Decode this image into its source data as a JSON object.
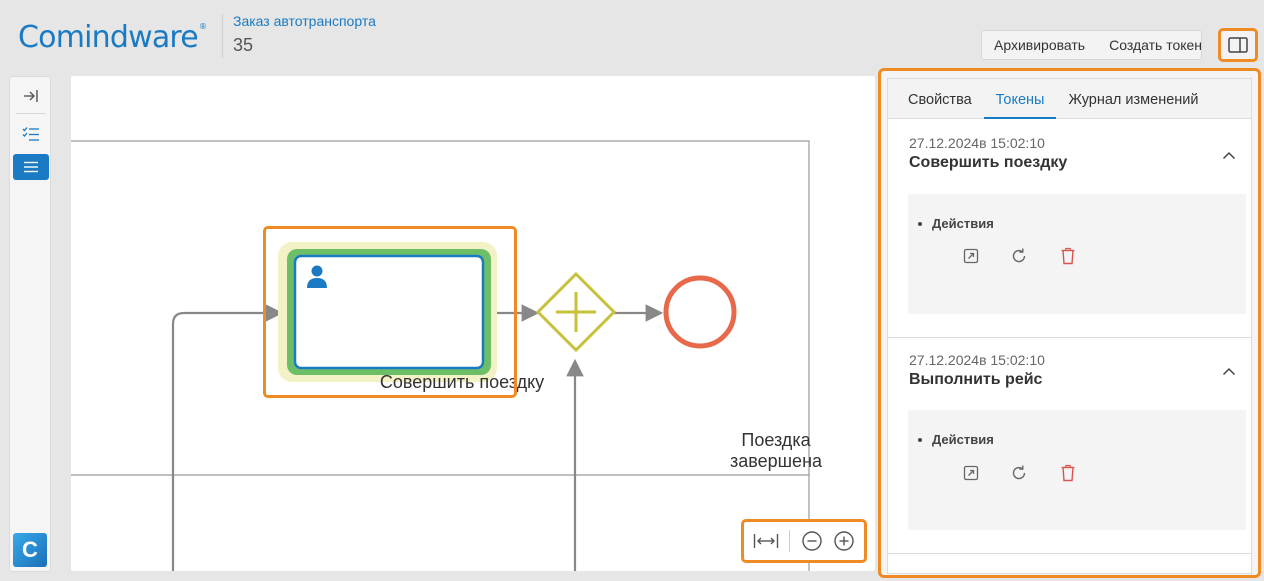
{
  "header": {
    "logo_text": "Comindware",
    "logo_mark": "®",
    "process_title": "Заказ автотранспорта",
    "process_id": "35",
    "toolbar": {
      "archive_label": "Архивировать",
      "create_token_label": "Создать токен"
    },
    "panel_toggle_icon": "panel-toggle-icon"
  },
  "sidebar": {
    "items": [
      {
        "icon": "collapse-arrow-icon"
      },
      {
        "icon": "checklist-icon"
      },
      {
        "icon": "list-icon",
        "active": true
      }
    ],
    "brand_tile_letter": "C"
  },
  "diagram": {
    "task_label": "Совершить поездку",
    "end_event_label": "Поездка завершена",
    "zoom_controls": {
      "fit_icon": "fit-width-icon",
      "zoom_out_icon": "zoom-out-icon",
      "zoom_in_icon": "zoom-in-icon"
    }
  },
  "panel": {
    "tabs": [
      {
        "label": "Свойства",
        "active": false
      },
      {
        "label": "Токены",
        "active": true
      },
      {
        "label": "Журнал изменений",
        "active": false
      }
    ],
    "tokens": [
      {
        "date": "27.12.2024в 15:02:10",
        "name": "Совершить поездку",
        "actions_label": "Действия"
      },
      {
        "date": "27.12.2024в 15:02:10",
        "name": "Выполнить рейс",
        "actions_label": "Действия"
      }
    ]
  },
  "colors": {
    "accent": "#1a7bc4",
    "highlight": "#f08a24",
    "end_event": "#e8684a",
    "gateway": "#c8c23a",
    "active_task": "#6dbf67",
    "delete": "#d9534f"
  }
}
